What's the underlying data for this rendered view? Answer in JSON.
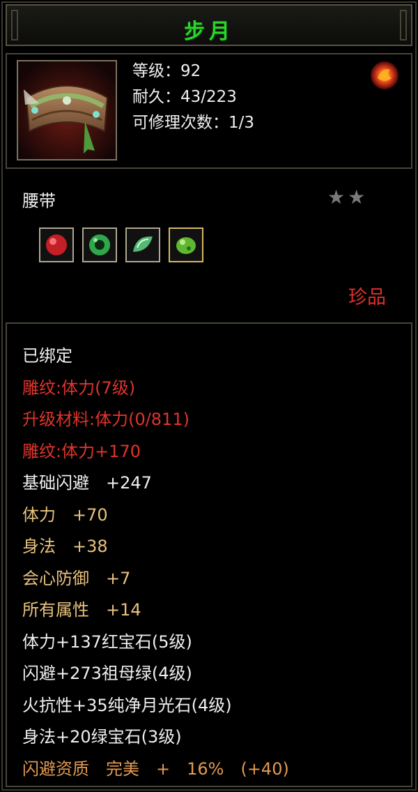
{
  "title": "步月",
  "header": {
    "level": "等级：92",
    "durability": "耐久：43/223",
    "repair_count": "可修理次数：1/3",
    "item_icon": "belt-icon",
    "rune_icon": "fire-rune-icon"
  },
  "item_type": "腰带",
  "stars": {
    "filled": 2,
    "glyph": "★★"
  },
  "gems": [
    {
      "icon": "red-gem-icon",
      "color": "#d22b2b"
    },
    {
      "icon": "emerald-gem-icon",
      "color": "#2ea84a"
    },
    {
      "icon": "moonstone-gem-icon",
      "color": "#5cc27a"
    },
    {
      "icon": "green-gem-icon",
      "color": "#6bbf3a"
    }
  ],
  "quality": "珍品",
  "properties": [
    {
      "text": "已绑定",
      "color": "white"
    },
    {
      "text": "雕纹:体力(7级)",
      "color": "red"
    },
    {
      "text": "升级材料:体力(0/811)",
      "color": "red"
    },
    {
      "text": "雕纹:体力+170",
      "color": "red"
    },
    {
      "text": "基础闪避　+247",
      "color": "white"
    },
    {
      "text": "体力　+70",
      "color": "gold"
    },
    {
      "text": "身法　+38",
      "color": "gold"
    },
    {
      "text": "会心防御　+7",
      "color": "gold"
    },
    {
      "text": "所有属性　+14",
      "color": "gold"
    },
    {
      "text": "体力+137红宝石(5级)",
      "color": "white"
    },
    {
      "text": "闪避+273祖母绿(4级)",
      "color": "white"
    },
    {
      "text": "火抗性+35纯净月光石(4级)",
      "color": "white"
    },
    {
      "text": "身法+20绿宝石(3级)",
      "color": "white"
    },
    {
      "text": "闪避资质　完美　+　16%　(+40)",
      "color": "orange"
    }
  ],
  "colors": {
    "title": "#2bd62b",
    "red": "#e2332c",
    "gold": "#e9c27e",
    "orange": "#e39a50",
    "white": "#f0f0f0"
  }
}
